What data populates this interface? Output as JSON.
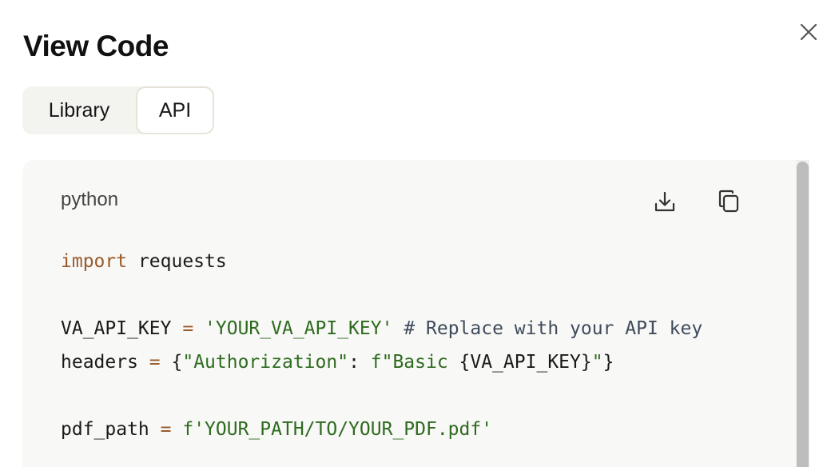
{
  "dialog": {
    "title": "View Code",
    "close_icon": "close-icon"
  },
  "tabs": [
    {
      "label": "Library",
      "selected": false
    },
    {
      "label": "API",
      "selected": true
    }
  ],
  "code_block": {
    "language": "python",
    "download_icon": "download-icon",
    "copy_icon": "copy-icon",
    "lines": [
      [
        {
          "t": "import",
          "k": "kw"
        },
        {
          "t": " requests",
          "k": "pl"
        }
      ],
      [],
      [
        {
          "t": "VA_API_KEY ",
          "k": "pl"
        },
        {
          "t": "=",
          "k": "op"
        },
        {
          "t": " ",
          "k": "pl"
        },
        {
          "t": "'YOUR_VA_API_KEY'",
          "k": "str"
        },
        {
          "t": " ",
          "k": "pl"
        },
        {
          "t": "# Replace with your API key",
          "k": "cm"
        }
      ],
      [
        {
          "t": "headers ",
          "k": "pl"
        },
        {
          "t": "=",
          "k": "op"
        },
        {
          "t": " {",
          "k": "pl"
        },
        {
          "t": "\"Authorization\"",
          "k": "str"
        },
        {
          "t": ": ",
          "k": "pl"
        },
        {
          "t": "f\"Basic ",
          "k": "str"
        },
        {
          "t": "{VA_API_KEY}",
          "k": "pl"
        },
        {
          "t": "\"",
          "k": "str"
        },
        {
          "t": "}",
          "k": "pl"
        }
      ],
      [],
      [
        {
          "t": "pdf_path ",
          "k": "pl"
        },
        {
          "t": "=",
          "k": "op"
        },
        {
          "t": " ",
          "k": "pl"
        },
        {
          "t": "f'YOUR_PATH/TO/YOUR_PDF.pdf'",
          "k": "str"
        }
      ]
    ]
  },
  "colors": {
    "keyword": "#9a5a2a",
    "string": "#2e6b1f",
    "comment": "#3f4b5c",
    "panel_bg": "#f8f8f6",
    "tab_bg": "#f3f3ef"
  }
}
